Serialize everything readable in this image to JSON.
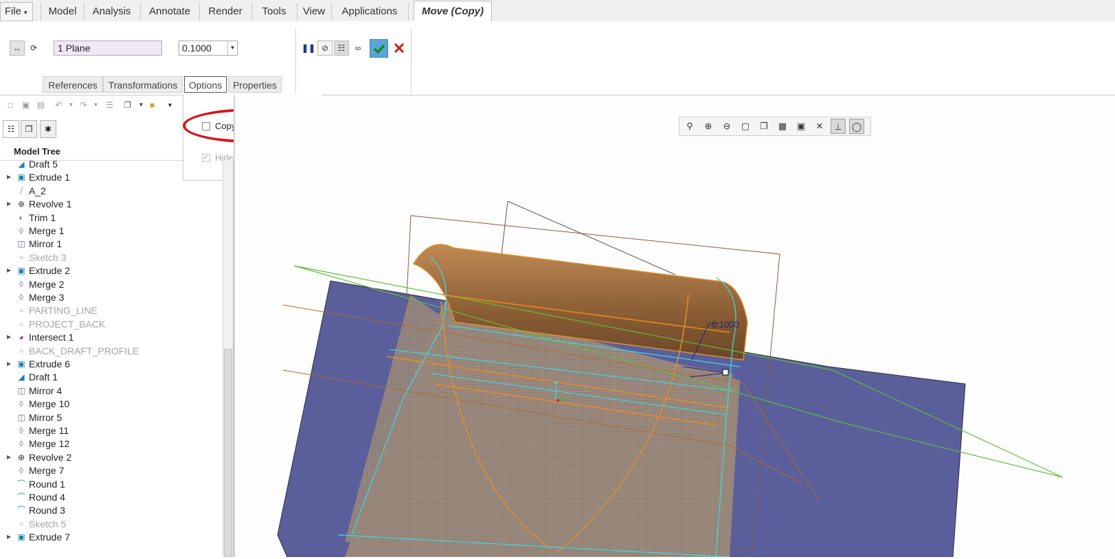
{
  "ribbon": {
    "file": "File",
    "tabs": [
      "Model",
      "Analysis",
      "Annotate",
      "Render",
      "Tools",
      "View",
      "Applications"
    ],
    "active_tab": "Move (Copy)"
  },
  "dashboard": {
    "references_value": "1 Plane",
    "distance_value": "0.1000",
    "slide_tabs": [
      "References",
      "Transformations",
      "Options",
      "Properties"
    ]
  },
  "options_panel": {
    "copy_label": "Copy original geometry",
    "copy_checked": false,
    "hide_label": "Hide original geometry",
    "hide_checked": true
  },
  "navigator": {
    "header": "Model Tree",
    "items": [
      {
        "label": "Draft 5",
        "icon": "draft-icon",
        "expandable": false,
        "muted": false
      },
      {
        "label": "Extrude 1",
        "icon": "extrude-icon",
        "expandable": true,
        "muted": false
      },
      {
        "label": "A_2",
        "icon": "axis-icon",
        "expandable": false,
        "muted": false
      },
      {
        "label": "Revolve 1",
        "icon": "revolve-icon",
        "expandable": true,
        "muted": false
      },
      {
        "label": "Trim 1",
        "icon": "trim-icon",
        "expandable": false,
        "muted": false
      },
      {
        "label": "Merge 1",
        "icon": "merge-icon",
        "expandable": false,
        "muted": false
      },
      {
        "label": "Mirror 1",
        "icon": "mirror-icon",
        "expandable": false,
        "muted": false
      },
      {
        "label": "Sketch 3",
        "icon": "sketch-icon",
        "expandable": false,
        "muted": true
      },
      {
        "label": "Extrude 2",
        "icon": "extrude-icon",
        "expandable": true,
        "muted": false
      },
      {
        "label": "Merge 2",
        "icon": "merge-icon",
        "expandable": false,
        "muted": false
      },
      {
        "label": "Merge 3",
        "icon": "merge-icon",
        "expandable": false,
        "muted": false
      },
      {
        "label": "PARTING_LINE",
        "icon": "sketch-icon",
        "expandable": false,
        "muted": true
      },
      {
        "label": "PROJECT_BACK",
        "icon": "sketch-icon",
        "expandable": false,
        "muted": true
      },
      {
        "label": "Intersect 1",
        "icon": "intersect-icon",
        "expandable": true,
        "muted": false
      },
      {
        "label": "BACK_DRAFT_PROFILE",
        "icon": "sketch-icon",
        "expandable": false,
        "muted": true
      },
      {
        "label": "Extrude 6",
        "icon": "extrude-icon",
        "expandable": true,
        "muted": false
      },
      {
        "label": "Draft 1",
        "icon": "draft-icon",
        "expandable": false,
        "muted": false
      },
      {
        "label": "Mirror 4",
        "icon": "mirror-icon",
        "expandable": false,
        "muted": false
      },
      {
        "label": "Merge 10",
        "icon": "merge-icon",
        "expandable": false,
        "muted": false
      },
      {
        "label": "Mirror 5",
        "icon": "mirror-icon",
        "expandable": false,
        "muted": false
      },
      {
        "label": "Merge 11",
        "icon": "merge-icon",
        "expandable": false,
        "muted": false
      },
      {
        "label": "Merge 12",
        "icon": "merge-icon",
        "expandable": false,
        "muted": false
      },
      {
        "label": "Revolve 2",
        "icon": "revolve-icon",
        "expandable": true,
        "muted": false
      },
      {
        "label": "Merge 7",
        "icon": "merge-icon",
        "expandable": false,
        "muted": false
      },
      {
        "label": "Round 1",
        "icon": "round-icon",
        "expandable": false,
        "muted": false
      },
      {
        "label": "Round 4",
        "icon": "round-icon",
        "expandable": false,
        "muted": false
      },
      {
        "label": "Round 3",
        "icon": "round-icon",
        "expandable": false,
        "muted": false
      },
      {
        "label": "Sketch 5",
        "icon": "sketch-icon",
        "expandable": false,
        "muted": true
      },
      {
        "label": "Extrude 7",
        "icon": "extrude-icon",
        "expandable": true,
        "muted": false
      }
    ]
  },
  "graphics": {
    "dimension_label": "0.1000"
  },
  "colors": {
    "highlight_ring": "#d7161b",
    "quilt_blue": "#5a5f9c",
    "surface_brown": "#a8764a",
    "edge_cyan": "#3fd6e0",
    "edge_orange": "#f08a1e",
    "plane_green": "#5fbf3a"
  }
}
